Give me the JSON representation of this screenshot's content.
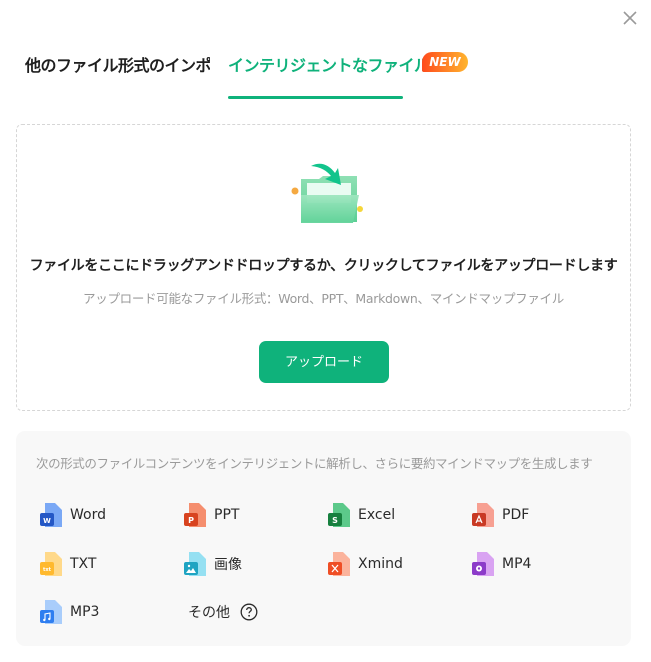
{
  "dialog": {
    "close_icon": "close-icon"
  },
  "tabs": [
    {
      "label": "他のファイル形式のインポ...",
      "active": false
    },
    {
      "label": "インテリジェントなファイル...",
      "active": true,
      "badge": "NEW"
    }
  ],
  "dropzone": {
    "icon": "folder-upload-icon",
    "title": "ファイルをここにドラッグアンドドロップするか、クリックしてファイルをアップロードします",
    "subtitle": "アップロード可能なファイル形式：Word、PPT、Markdown、マインドマップファイル",
    "upload_button": "アップロード"
  },
  "formats": {
    "description": "次の形式のファイルコンテンツをインテリジェントに解析し、さらに要約マインドマップを生成します",
    "items": [
      {
        "label": "Word",
        "icon": "word-file-icon",
        "color": "#2f6fe0"
      },
      {
        "label": "PPT",
        "icon": "ppt-file-icon",
        "color": "#e8542e"
      },
      {
        "label": "Excel",
        "icon": "excel-file-icon",
        "color": "#1e9a55"
      },
      {
        "label": "PDF",
        "icon": "pdf-file-icon",
        "color": "#d9452e"
      },
      {
        "label": "TXT",
        "icon": "txt-file-icon",
        "color": "#ffb92e"
      },
      {
        "label": "画像",
        "icon": "image-file-icon",
        "color": "#2bb0cf"
      },
      {
        "label": "Xmind",
        "icon": "xmind-file-icon",
        "color": "#f0552b"
      },
      {
        "label": "MP4",
        "icon": "mp4-file-icon",
        "color": "#9b45d6"
      },
      {
        "label": "MP3",
        "icon": "mp3-file-icon",
        "color": "#3a86f0"
      },
      {
        "label": "その他",
        "icon": "help-icon"
      }
    ]
  },
  "colors": {
    "accent": "#0fb27b",
    "badge_start": "#ff4a1c",
    "badge_end": "#ffb52e"
  }
}
